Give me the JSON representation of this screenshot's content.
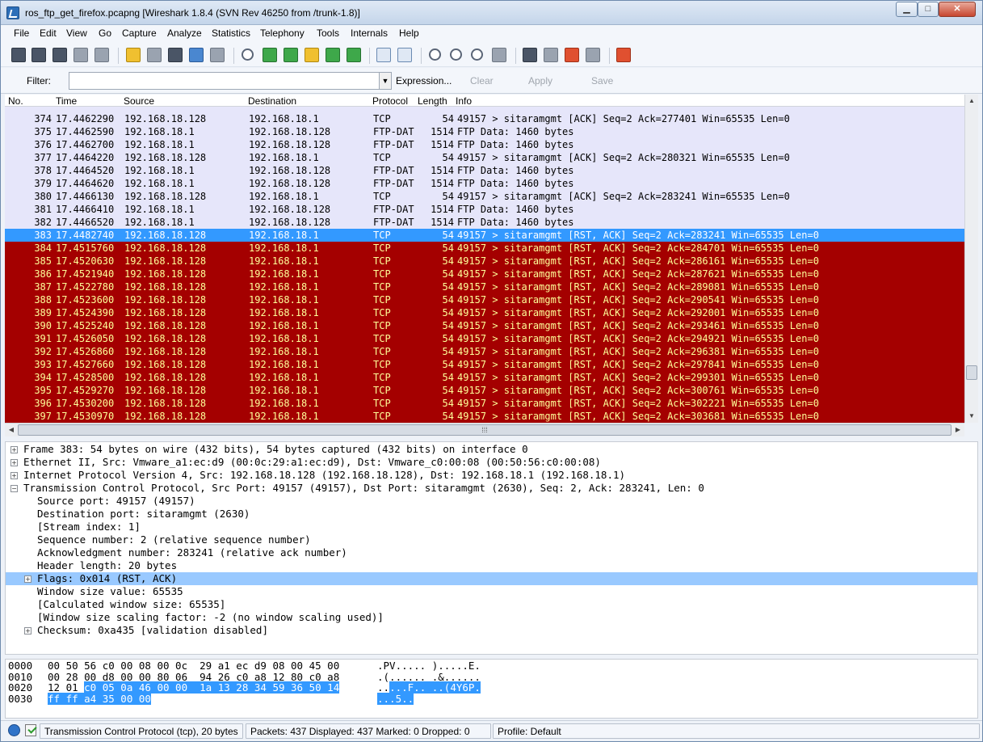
{
  "window": {
    "title": "ros_ftp_get_firefox.pcapng   [Wireshark 1.8.4  (SVN Rev 46250 from /trunk-1.8)]",
    "min_glyph": "▁",
    "max_glyph": "□",
    "close_glyph": "✕"
  },
  "menu": [
    "File",
    "Edit",
    "View",
    "Go",
    "Capture",
    "Analyze",
    "Statistics",
    "Telephony",
    "Tools",
    "Internals",
    "Help"
  ],
  "filter": {
    "label": "Filter:",
    "value": "",
    "expression": "Expression...",
    "clear": "Clear",
    "apply": "Apply",
    "save": "Save"
  },
  "columns": {
    "no": "No.",
    "time": "Time",
    "source": "Source",
    "destination": "Destination",
    "protocol": "Protocol",
    "length": "Length",
    "info": "Info"
  },
  "packets": [
    {
      "no": "374",
      "time": "17.4462290",
      "src": "192.168.18.128",
      "dst": "192.168.18.1",
      "proto": "TCP",
      "len": "54",
      "info": "49157 > sitaramgmt [ACK] Seq=2 Ack=277401 Win=65535 Len=0",
      "style": "ftp"
    },
    {
      "no": "375",
      "time": "17.4462590",
      "src": "192.168.18.1",
      "dst": "192.168.18.128",
      "proto": "FTP-DAT",
      "len": "1514",
      "info": "FTP Data: 1460 bytes",
      "style": "ftp"
    },
    {
      "no": "376",
      "time": "17.4462700",
      "src": "192.168.18.1",
      "dst": "192.168.18.128",
      "proto": "FTP-DAT",
      "len": "1514",
      "info": "FTP Data: 1460 bytes",
      "style": "ftp"
    },
    {
      "no": "377",
      "time": "17.4464220",
      "src": "192.168.18.128",
      "dst": "192.168.18.1",
      "proto": "TCP",
      "len": "54",
      "info": "49157 > sitaramgmt [ACK] Seq=2 Ack=280321 Win=65535 Len=0",
      "style": "ftp"
    },
    {
      "no": "378",
      "time": "17.4464520",
      "src": "192.168.18.1",
      "dst": "192.168.18.128",
      "proto": "FTP-DAT",
      "len": "1514",
      "info": "FTP Data: 1460 bytes",
      "style": "ftp"
    },
    {
      "no": "379",
      "time": "17.4464620",
      "src": "192.168.18.1",
      "dst": "192.168.18.128",
      "proto": "FTP-DAT",
      "len": "1514",
      "info": "FTP Data: 1460 bytes",
      "style": "ftp"
    },
    {
      "no": "380",
      "time": "17.4466130",
      "src": "192.168.18.128",
      "dst": "192.168.18.1",
      "proto": "TCP",
      "len": "54",
      "info": "49157 > sitaramgmt [ACK] Seq=2 Ack=283241 Win=65535 Len=0",
      "style": "ftp"
    },
    {
      "no": "381",
      "time": "17.4466410",
      "src": "192.168.18.1",
      "dst": "192.168.18.128",
      "proto": "FTP-DAT",
      "len": "1514",
      "info": "FTP Data: 1460 bytes",
      "style": "ftp"
    },
    {
      "no": "382",
      "time": "17.4466520",
      "src": "192.168.18.1",
      "dst": "192.168.18.128",
      "proto": "FTP-DAT",
      "len": "1514",
      "info": "FTP Data: 1460 bytes",
      "style": "ftp"
    },
    {
      "no": "383",
      "time": "17.4482740",
      "src": "192.168.18.128",
      "dst": "192.168.18.1",
      "proto": "TCP",
      "len": "54",
      "info": "49157 > sitaramgmt [RST, ACK] Seq=2 Ack=283241 Win=65535 Len=0",
      "style": "sel"
    },
    {
      "no": "384",
      "time": "17.4515760",
      "src": "192.168.18.128",
      "dst": "192.168.18.1",
      "proto": "TCP",
      "len": "54",
      "info": "49157 > sitaramgmt [RST, ACK] Seq=2 Ack=284701 Win=65535 Len=0",
      "style": "rst"
    },
    {
      "no": "385",
      "time": "17.4520630",
      "src": "192.168.18.128",
      "dst": "192.168.18.1",
      "proto": "TCP",
      "len": "54",
      "info": "49157 > sitaramgmt [RST, ACK] Seq=2 Ack=286161 Win=65535 Len=0",
      "style": "rst"
    },
    {
      "no": "386",
      "time": "17.4521940",
      "src": "192.168.18.128",
      "dst": "192.168.18.1",
      "proto": "TCP",
      "len": "54",
      "info": "49157 > sitaramgmt [RST, ACK] Seq=2 Ack=287621 Win=65535 Len=0",
      "style": "rst"
    },
    {
      "no": "387",
      "time": "17.4522780",
      "src": "192.168.18.128",
      "dst": "192.168.18.1",
      "proto": "TCP",
      "len": "54",
      "info": "49157 > sitaramgmt [RST, ACK] Seq=2 Ack=289081 Win=65535 Len=0",
      "style": "rst"
    },
    {
      "no": "388",
      "time": "17.4523600",
      "src": "192.168.18.128",
      "dst": "192.168.18.1",
      "proto": "TCP",
      "len": "54",
      "info": "49157 > sitaramgmt [RST, ACK] Seq=2 Ack=290541 Win=65535 Len=0",
      "style": "rst"
    },
    {
      "no": "389",
      "time": "17.4524390",
      "src": "192.168.18.128",
      "dst": "192.168.18.1",
      "proto": "TCP",
      "len": "54",
      "info": "49157 > sitaramgmt [RST, ACK] Seq=2 Ack=292001 Win=65535 Len=0",
      "style": "rst"
    },
    {
      "no": "390",
      "time": "17.4525240",
      "src": "192.168.18.128",
      "dst": "192.168.18.1",
      "proto": "TCP",
      "len": "54",
      "info": "49157 > sitaramgmt [RST, ACK] Seq=2 Ack=293461 Win=65535 Len=0",
      "style": "rst"
    },
    {
      "no": "391",
      "time": "17.4526050",
      "src": "192.168.18.128",
      "dst": "192.168.18.1",
      "proto": "TCP",
      "len": "54",
      "info": "49157 > sitaramgmt [RST, ACK] Seq=2 Ack=294921 Win=65535 Len=0",
      "style": "rst"
    },
    {
      "no": "392",
      "time": "17.4526860",
      "src": "192.168.18.128",
      "dst": "192.168.18.1",
      "proto": "TCP",
      "len": "54",
      "info": "49157 > sitaramgmt [RST, ACK] Seq=2 Ack=296381 Win=65535 Len=0",
      "style": "rst"
    },
    {
      "no": "393",
      "time": "17.4527660",
      "src": "192.168.18.128",
      "dst": "192.168.18.1",
      "proto": "TCP",
      "len": "54",
      "info": "49157 > sitaramgmt [RST, ACK] Seq=2 Ack=297841 Win=65535 Len=0",
      "style": "rst"
    },
    {
      "no": "394",
      "time": "17.4528500",
      "src": "192.168.18.128",
      "dst": "192.168.18.1",
      "proto": "TCP",
      "len": "54",
      "info": "49157 > sitaramgmt [RST, ACK] Seq=2 Ack=299301 Win=65535 Len=0",
      "style": "rst"
    },
    {
      "no": "395",
      "time": "17.4529270",
      "src": "192.168.18.128",
      "dst": "192.168.18.1",
      "proto": "TCP",
      "len": "54",
      "info": "49157 > sitaramgmt [RST, ACK] Seq=2 Ack=300761 Win=65535 Len=0",
      "style": "rst"
    },
    {
      "no": "396",
      "time": "17.4530200",
      "src": "192.168.18.128",
      "dst": "192.168.18.1",
      "proto": "TCP",
      "len": "54",
      "info": "49157 > sitaramgmt [RST, ACK] Seq=2 Ack=302221 Win=65535 Len=0",
      "style": "rst"
    },
    {
      "no": "397",
      "time": "17.4530970",
      "src": "192.168.18.128",
      "dst": "192.168.18.1",
      "proto": "TCP",
      "len": "54",
      "info": "49157 > sitaramgmt [RST, ACK] Seq=2 Ack=303681 Win=65535 Len=0",
      "style": "rst"
    }
  ],
  "details": [
    {
      "text": "Frame 383: 54 bytes on wire (432 bits), 54 bytes captured (432 bits) on interface 0",
      "level": 0,
      "expander": "+"
    },
    {
      "text": "Ethernet II, Src: Vmware_a1:ec:d9 (00:0c:29:a1:ec:d9), Dst: Vmware_c0:00:08 (00:50:56:c0:00:08)",
      "level": 0,
      "expander": "+"
    },
    {
      "text": "Internet Protocol Version 4, Src: 192.168.18.128 (192.168.18.128), Dst: 192.168.18.1 (192.168.18.1)",
      "level": 0,
      "expander": "+"
    },
    {
      "text": "Transmission Control Protocol, Src Port: 49157 (49157), Dst Port: sitaramgmt (2630), Seq: 2, Ack: 283241, Len: 0",
      "level": 0,
      "expander": "-"
    },
    {
      "text": "Source port: 49157 (49157)",
      "level": 1,
      "expander": ""
    },
    {
      "text": "Destination port: sitaramgmt (2630)",
      "level": 1,
      "expander": ""
    },
    {
      "text": "[Stream index: 1]",
      "level": 1,
      "expander": ""
    },
    {
      "text": "Sequence number: 2    (relative sequence number)",
      "level": 1,
      "expander": ""
    },
    {
      "text": "Acknowledgment number: 283241    (relative ack number)",
      "level": 1,
      "expander": ""
    },
    {
      "text": "Header length: 20 bytes",
      "level": 1,
      "expander": ""
    },
    {
      "text": "Flags: 0x014 (RST, ACK)",
      "level": 1,
      "expander": "+",
      "selected": true
    },
    {
      "text": "Window size value: 65535",
      "level": 1,
      "expander": ""
    },
    {
      "text": "[Calculated window size: 65535]",
      "level": 1,
      "expander": ""
    },
    {
      "text": "[Window size scaling factor: -2 (no window scaling used)]",
      "level": 1,
      "expander": ""
    },
    {
      "text": "Checksum: 0xa435 [validation disabled]",
      "level": 1,
      "expander": "+"
    }
  ],
  "bytes": [
    {
      "offset": "0000",
      "hex": "00 50 56 c0 00 08 00 0c  29 a1 ec d9 08 00 45 00",
      "hex_hl": "",
      "ascii": ".PV..... ).....E.",
      "ascii_hl": ""
    },
    {
      "offset": "0010",
      "hex": "00 28 00 d8 00 00 80 06  94 26 c0 a8 12 80 c0 a8",
      "hex_hl": "",
      "ascii": ".(...... .&......",
      "ascii_hl": ""
    },
    {
      "offset": "0020",
      "hex": "12 01 ",
      "hex_hl": "c0 05 0a 46 00 00  1a 13 28 34 59 36 50 14",
      "ascii": "..",
      "ascii_hl": "...F.. ..(4Y6P."
    },
    {
      "offset": "0030",
      "hex": "",
      "hex_hl": "ff ff a4 35 00 00",
      "ascii": "",
      "ascii_hl": "...5.."
    }
  ],
  "status": {
    "field": "Transmission Control Protocol (tcp), 20 bytes",
    "packets": "Packets: 437 Displayed: 437 Marked: 0 Dropped: 0",
    "profile": "Profile: Default"
  },
  "colors": {
    "selected": "#3399ff",
    "rst_bg": "#a40000",
    "rst_fg": "#ffff99",
    "ftp_bg": "#e6e6fa"
  }
}
